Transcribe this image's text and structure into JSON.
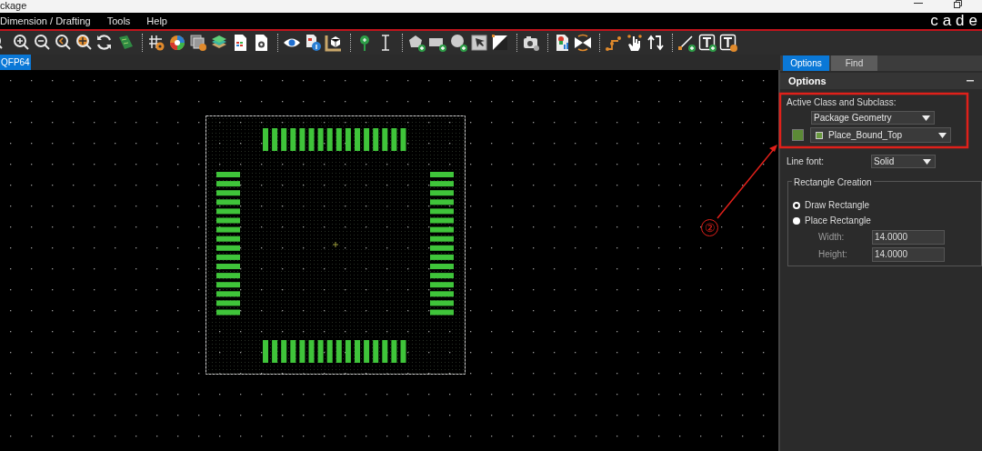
{
  "window": {
    "title": "ckage",
    "logo": "cade"
  },
  "menu": [
    "Dimension / Drafting",
    "Tools",
    "Help"
  ],
  "document_tabs": [
    {
      "label": "QFP64",
      "selected": true
    }
  ],
  "panel": {
    "tabs": [
      {
        "label": "Options",
        "selected": true
      },
      {
        "label": "Find",
        "selected": false
      }
    ],
    "header": "Options",
    "class_label": "Active Class and Subclass:",
    "class": "Package Geometry",
    "subclass": "Place_Bound_Top",
    "line_font_label": "Line font:",
    "line_font": "Solid",
    "group_title": "Rectangle Creation",
    "modes": [
      {
        "label": "Draw Rectangle",
        "selected": true
      },
      {
        "label": "Place Rectangle",
        "selected": false
      }
    ],
    "fields": [
      {
        "label": "Width:",
        "value": "14.0000"
      },
      {
        "label": "Height:",
        "value": "14.0000"
      }
    ]
  },
  "annotation": {
    "label": "②"
  }
}
